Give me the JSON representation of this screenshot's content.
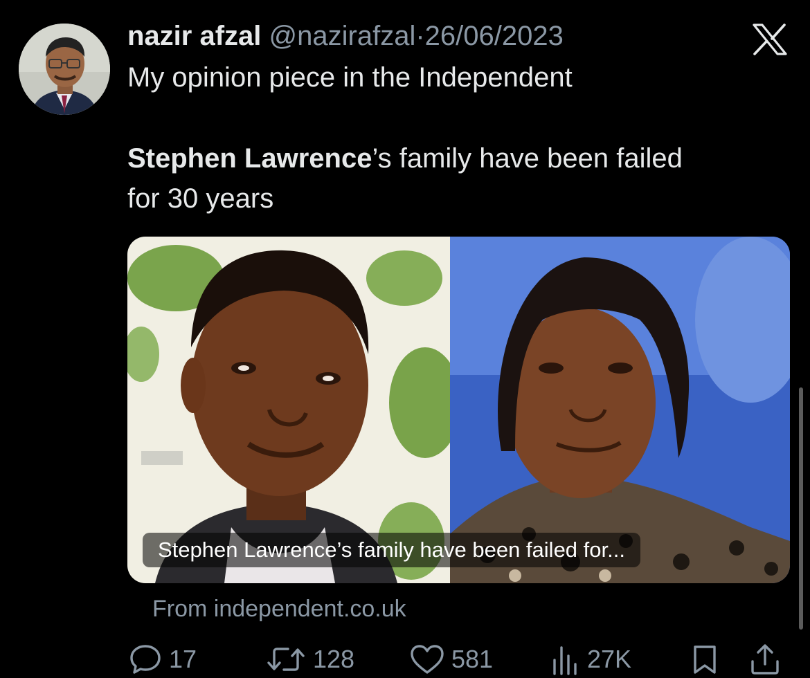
{
  "author": {
    "display_name": "nazir afzal",
    "handle": "@nazirafzal",
    "separator": "·",
    "date": "26/06/2023"
  },
  "tweet": {
    "line1": "My opinion piece in the Independent",
    "headline_bold": "Stephen Lawrence",
    "headline_rest": "’s family have been failed",
    "headline_line2": "for 30 years"
  },
  "link_card": {
    "caption": "Stephen Lawrence’s family have been failed for...",
    "source": "From independent.co.uk"
  },
  "actions": {
    "replies": "17",
    "retweets": "128",
    "likes": "581",
    "views": "27K"
  },
  "icons": {
    "brand": "x-logo-icon",
    "reply": "comment-bubble-icon",
    "retweet": "retweet-arrows-icon",
    "like": "heart-icon",
    "views": "bar-chart-icon",
    "bookmark": "bookmark-icon",
    "share": "share-upload-icon"
  },
  "colors": {
    "background": "#000000",
    "primary_text": "#e7e9ea",
    "secondary_text": "#8b98a5"
  }
}
